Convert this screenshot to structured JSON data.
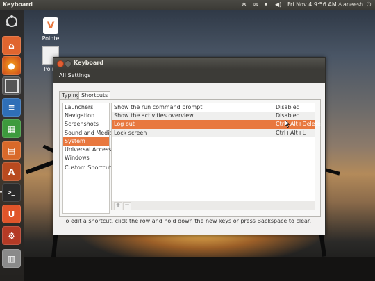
{
  "top_panel": {
    "app_title": "Keyboard",
    "clock": "Fri Nov  4  9:56 AM",
    "user": "aneesh"
  },
  "desktop": {
    "icons": [
      {
        "label": "Pointe"
      },
      {
        "label": "Point"
      }
    ]
  },
  "window": {
    "title": "Keyboard",
    "toolbar_label": "All Settings",
    "tabs": [
      {
        "label": "Typing",
        "active": false
      },
      {
        "label": "Shortcuts",
        "active": true
      }
    ],
    "categories": [
      {
        "label": "Launchers"
      },
      {
        "label": "Navigation"
      },
      {
        "label": "Screenshots"
      },
      {
        "label": "Sound and Media"
      },
      {
        "label": "System",
        "selected": true
      },
      {
        "label": "Universal Access"
      },
      {
        "label": "Windows"
      },
      {
        "label": "Custom Shortcuts"
      }
    ],
    "shortcuts": [
      {
        "name": "Show the run command prompt",
        "keys": "Disabled"
      },
      {
        "name": "Show the activities overview",
        "keys": "Disabled"
      },
      {
        "name": "Log out",
        "keys": "Ctrl+Alt+Delete",
        "selected": true
      },
      {
        "name": "Lock screen",
        "keys": "Ctrl+Alt+L"
      }
    ],
    "add_label": "+",
    "remove_label": "−",
    "hint": "To edit a shortcut, click the row and hold down the new keys or press Backspace to clear."
  },
  "colors": {
    "selection": "#e8783f",
    "panel": "#3c3b37",
    "close": "#e25f33"
  }
}
